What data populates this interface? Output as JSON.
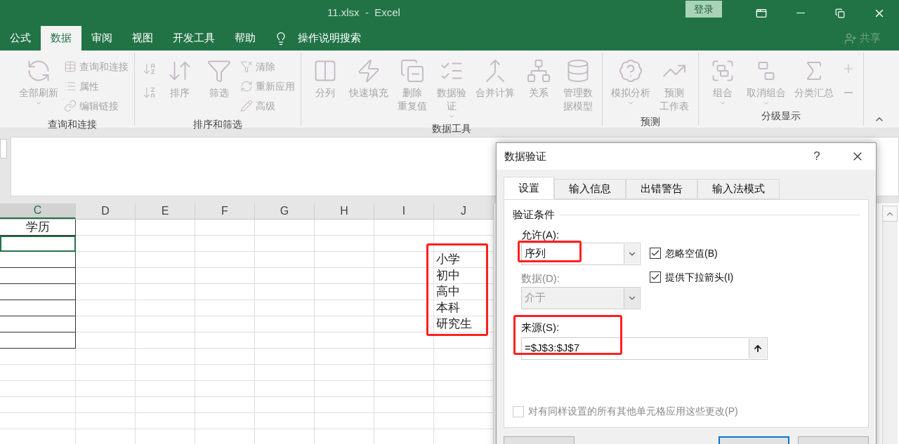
{
  "window": {
    "title": "11.xlsx  -  Excel",
    "sign_in": "登录"
  },
  "ribbon_tabs": [
    {
      "label": "公式",
      "selected": false
    },
    {
      "label": "数据",
      "selected": true
    },
    {
      "label": "审阅",
      "selected": false
    },
    {
      "label": "视图",
      "selected": false
    },
    {
      "label": "开发工具",
      "selected": false
    },
    {
      "label": "帮助",
      "selected": false
    }
  ],
  "tell_me": "操作说明搜索",
  "share": {
    "label": "共享",
    "disabled": true
  },
  "ribbon": {
    "groups": [
      {
        "label": "查询和连接",
        "commands": [
          {
            "kind": "large",
            "label": "全部刷新",
            "menu": true,
            "disabled": true
          },
          {
            "kind": "small",
            "label": "查询和连接",
            "disabled": true
          },
          {
            "kind": "small",
            "label": "属性",
            "disabled": true
          },
          {
            "kind": "small",
            "label": "编辑链接",
            "disabled": true
          }
        ]
      },
      {
        "label": "排序和筛选",
        "commands": [
          {
            "kind": "icon",
            "disabled": true
          },
          {
            "kind": "icon",
            "disabled": true
          },
          {
            "kind": "large",
            "label": "排序",
            "menu": false,
            "disabled": true
          },
          {
            "kind": "large",
            "label": "筛选",
            "menu": false,
            "disabled": true
          },
          {
            "kind": "small",
            "label": "清除",
            "disabled": true
          },
          {
            "kind": "small",
            "label": "重新应用",
            "disabled": true
          },
          {
            "kind": "small",
            "label": "高级",
            "disabled": true
          }
        ]
      },
      {
        "label": "数据工具",
        "commands": [
          {
            "kind": "large",
            "label": "分列",
            "menu": false,
            "disabled": true
          },
          {
            "kind": "large",
            "label": "快速填充",
            "menu": false,
            "disabled": true
          },
          {
            "kind": "large",
            "lines": [
              "删除",
              "重复值"
            ],
            "menu": false,
            "disabled": true
          },
          {
            "kind": "large",
            "lines": [
              "数据验",
              "证"
            ],
            "menu": true,
            "disabled": true
          },
          {
            "kind": "large",
            "label": "合并计算",
            "menu": false,
            "disabled": true
          },
          {
            "kind": "large",
            "label": "关系",
            "menu": false,
            "disabled": true
          },
          {
            "kind": "large",
            "lines": [
              "管理数",
              "据模型"
            ],
            "menu": false,
            "disabled": true
          }
        ]
      },
      {
        "label": "预测",
        "commands": [
          {
            "kind": "large",
            "label": "模拟分析",
            "menu": true,
            "disabled": true
          },
          {
            "kind": "large",
            "lines": [
              "预测",
              "工作表"
            ],
            "menu": false,
            "disabled": true
          }
        ]
      },
      {
        "label": "分级显示",
        "commands": [
          {
            "kind": "large",
            "label": "组合",
            "menu": true,
            "disabled": true
          },
          {
            "kind": "large",
            "label": "取消组合",
            "menu": true,
            "disabled": true
          },
          {
            "kind": "large",
            "label": "分类汇总",
            "menu": false,
            "disabled": true
          },
          {
            "kind": "icon",
            "disabled": true
          },
          {
            "kind": "icon",
            "disabled": true
          }
        ]
      }
    ]
  },
  "sheet": {
    "columns": [
      {
        "label": "C",
        "selected": true
      },
      {
        "label": "D",
        "selected": false
      },
      {
        "label": "E",
        "selected": false
      },
      {
        "label": "F",
        "selected": false
      },
      {
        "label": "G",
        "selected": false
      },
      {
        "label": "H",
        "selected": false
      },
      {
        "label": "I",
        "selected": false
      },
      {
        "label": "J",
        "selected": false
      }
    ],
    "header_cell": "学历",
    "list_values": [
      "小学",
      "初中",
      "高中",
      "本科",
      "研究生"
    ],
    "list_highlighted": true
  },
  "dialog": {
    "title": "数据验证",
    "help": "?",
    "tabs": [
      {
        "label": "设置",
        "selected": true
      },
      {
        "label": "输入信息",
        "selected": false
      },
      {
        "label": "出错警告",
        "selected": false
      },
      {
        "label": "输入法模式",
        "selected": false
      }
    ],
    "group_label": "验证条件",
    "allow": {
      "label": "允许(A):",
      "value": "序列",
      "highlighted": true
    },
    "ignore_blank": {
      "label": "忽略空值(B)",
      "checked": true
    },
    "in_cell_dropdown": {
      "label": "提供下拉箭头(I)",
      "checked": true
    },
    "data": {
      "label": "数据(D):",
      "value": "介于",
      "disabled": true
    },
    "source": {
      "label": "来源(S):",
      "value": "=$J$3:$J$7",
      "highlighted": true
    },
    "apply_all": {
      "label": "对有同样设置的所有其他单元格应用这些更改(P)",
      "checked": false,
      "disabled": true
    }
  }
}
